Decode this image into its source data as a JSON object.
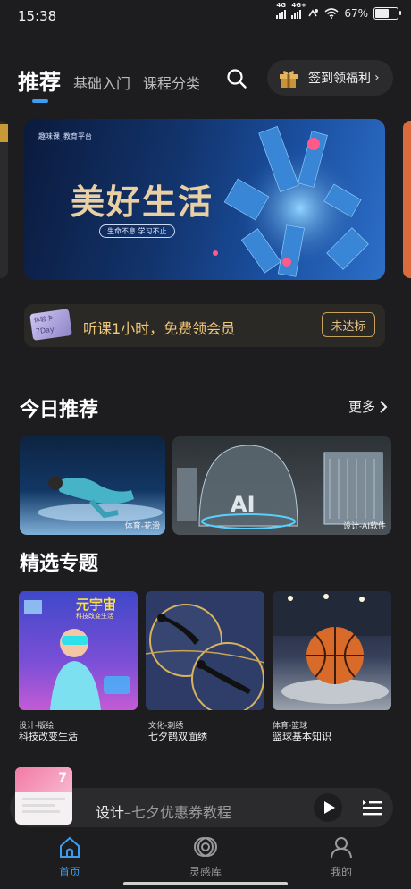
{
  "status_bar": {
    "time": "15:38",
    "network1": "4G",
    "network2": "4G+",
    "battery": "67%",
    "battery_level": 0.67
  },
  "header": {
    "tabs": [
      {
        "label": "推荐",
        "active": true
      },
      {
        "label": "基础入门"
      },
      {
        "label": "课程分类"
      }
    ],
    "checkin_label": "签到领福利"
  },
  "banner": {
    "brand": "趣味课_教育平台",
    "title": "美好生活",
    "subtitle": "生命不息 学习不止"
  },
  "promo": {
    "card_label": "体验卡",
    "card_sub": "7Day",
    "text": "听课1小时，免费领会员",
    "button": "未达标"
  },
  "today": {
    "title": "今日推荐",
    "more": "更多",
    "items": [
      {
        "caption": "体育-花滑"
      },
      {
        "caption": "设计-AI软件",
        "badge": "AI"
      }
    ]
  },
  "topics": {
    "title": "精选专题",
    "items": [
      {
        "category": "设计-版绘",
        "title": "科技改变生活",
        "art_text": "元宇宙",
        "art_sub": "科技改变生活"
      },
      {
        "category": "文化-刺绣",
        "title": "七夕鹊双面绣"
      },
      {
        "category": "体育-篮球",
        "title": "篮球基本知识"
      }
    ]
  },
  "player": {
    "category": "设计",
    "title": "七夕优惠券教程",
    "cover_num": "7"
  },
  "bottom_nav": [
    {
      "label": "首页",
      "active": true,
      "icon": "home-icon"
    },
    {
      "label": "灵感库",
      "icon": "inspiration-icon"
    },
    {
      "label": "我的",
      "icon": "user-icon"
    }
  ],
  "colors": {
    "accent": "#3b9cf0",
    "gold": "#f0c879",
    "background": "#1d1d20"
  }
}
